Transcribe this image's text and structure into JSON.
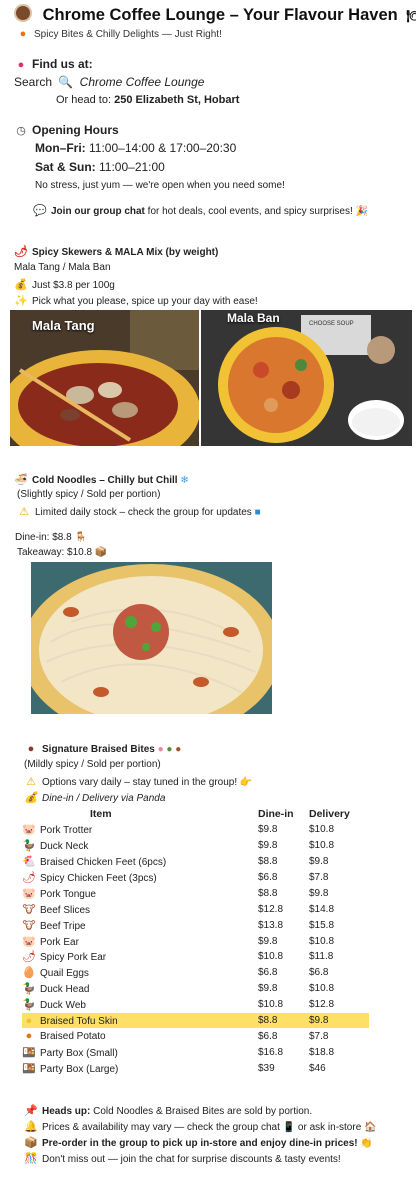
{
  "header": {
    "icon": "coffee-cup-icon",
    "title": "Chrome Coffee Lounge – Your Flavour Haven",
    "title_end_icon": "plate-icon",
    "subtitle": "Spicy Bites & Chilly Delights — Just Right!"
  },
  "location": {
    "heading": "Find us at:",
    "search_prefix": "Search",
    "search_term": "Chrome Coffee Lounge",
    "or_head_to": "Or head to:",
    "address": "250 Elizabeth St, Hobart"
  },
  "hours": {
    "heading": "Opening Hours",
    "weekday_label": "Mon–Fri:",
    "weekday_hours": "11:00–14:00 & 17:00–20:30",
    "weekend_label": "Sat & Sun:",
    "weekend_hours": "11:00–21:00",
    "note": "No stress, just yum — we're open when you need some!",
    "chat_bold": "Join our group chat",
    "chat_rest": "for hot deals, cool events, and spicy surprises!"
  },
  "skewers": {
    "heading": "Spicy Skewers & MALA Mix (by weight)",
    "types": "Mala Tang / Mala Ban",
    "price": "Just $3.8 per 100g",
    "note": "Pick what you please, spice up your day with ease!",
    "photo_left_label": "Mala Tang",
    "photo_right_label": "Mala Ban",
    "photo_right_sign": "CHOOSE SOUP"
  },
  "noodles": {
    "heading": "Cold Noodles – Chilly but Chill",
    "portion": "(Slightly spicy / Sold per portion)",
    "stock": "Limited daily stock – check the group for updates",
    "dine_in": "Dine-in: $8.8",
    "takeaway": "Takeaway: $10.8"
  },
  "braised": {
    "heading": "Signature Braised Bites",
    "portion": "(Mildly spicy / Sold per portion)",
    "options": "Options vary daily – stay tuned in the group!",
    "delivery": "Dine-in / Delivery via Panda",
    "columns": [
      "Item",
      "Dine-in",
      "Delivery"
    ],
    "items": [
      {
        "icon": "pig-icon",
        "name": "Pork Trotter",
        "dine": "$9.8",
        "delivery": "$10.8"
      },
      {
        "icon": "duck-icon",
        "name": "Duck Neck",
        "dine": "$9.8",
        "delivery": "$10.8"
      },
      {
        "icon": "chicken-icon",
        "name": "Braised Chicken Feet (6pcs)",
        "dine": "$8.8",
        "delivery": "$9.8"
      },
      {
        "icon": "chili-icon",
        "name": "Spicy Chicken Feet (3pcs)",
        "dine": "$6.8",
        "delivery": "$7.8"
      },
      {
        "icon": "pig-icon",
        "name": "Pork Tongue",
        "dine": "$8.8",
        "delivery": "$9.8"
      },
      {
        "icon": "cow-icon",
        "name": "Beef Slices",
        "dine": "$12.8",
        "delivery": "$14.8"
      },
      {
        "icon": "cow-icon",
        "name": "Beef Tripe",
        "dine": "$13.8",
        "delivery": "$15.8"
      },
      {
        "icon": "pig-icon",
        "name": "Pork Ear",
        "dine": "$9.8",
        "delivery": "$10.8"
      },
      {
        "icon": "chili-icon",
        "name": "Spicy Pork Ear",
        "dine": "$10.8",
        "delivery": "$11.8"
      },
      {
        "icon": "egg-icon",
        "name": "Quail Eggs",
        "dine": "$6.8",
        "delivery": "$6.8"
      },
      {
        "icon": "duck-icon",
        "name": "Duck Head",
        "dine": "$9.8",
        "delivery": "$10.8"
      },
      {
        "icon": "duck-icon",
        "name": "Duck Web",
        "dine": "$10.8",
        "delivery": "$12.8"
      },
      {
        "icon": "tofu-icon",
        "name": "Braised Tofu Skin",
        "dine": "$8.8",
        "delivery": "$9.8"
      },
      {
        "icon": "potato-icon",
        "name": "Braised Potato",
        "dine": "$6.8",
        "delivery": "$7.8"
      },
      {
        "icon": "party-box-icon",
        "name": "Party Box (Small)",
        "dine": "$16.8",
        "delivery": "$18.8"
      },
      {
        "icon": "party-box-icon",
        "name": "Party Box (Large)",
        "dine": "$39",
        "delivery": "$46"
      }
    ],
    "highlight_color": "#ffe066"
  },
  "footer": {
    "heads_up_bold": "Heads up:",
    "heads_up_rest": "Cold Noodles & Braised Bites are sold by portion.",
    "prices_note": "Prices & availability may vary — check the group chat",
    "prices_note_end": "or ask in-store",
    "preorder": "Pre-order in the group to pick up in-store and enjoy dine-in prices!",
    "dont_miss": "Don't miss out — join the chat for surprise discounts & tasty events!"
  }
}
